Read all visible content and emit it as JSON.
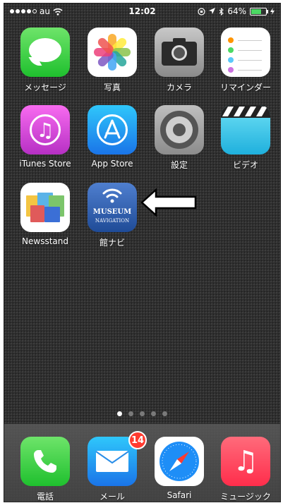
{
  "status_bar": {
    "carrier": "au",
    "time": "12:02",
    "battery": "64%"
  },
  "home_screen": {
    "apps": [
      {
        "label": "メッセージ",
        "icon": "messages-icon"
      },
      {
        "label": "写真",
        "icon": "photos-icon"
      },
      {
        "label": "カメラ",
        "icon": "camera-icon"
      },
      {
        "label": "リマインダー",
        "icon": "reminders-icon"
      },
      {
        "label": "iTunes Store",
        "icon": "itunes-store-icon"
      },
      {
        "label": "App Store",
        "icon": "app-store-icon"
      },
      {
        "label": "設定",
        "icon": "settings-icon"
      },
      {
        "label": "ビデオ",
        "icon": "videos-icon"
      },
      {
        "label": "Newsstand",
        "icon": "newsstand-icon"
      },
      {
        "label": "館ナビ",
        "icon": "museum-navigation-icon",
        "icon_text_1": "MUSEUM",
        "icon_text_2": "NAVIGATION"
      }
    ],
    "page_count": 5,
    "current_page": 1
  },
  "dock": {
    "apps": [
      {
        "label": "電話",
        "icon": "phone-icon"
      },
      {
        "label": "メール",
        "icon": "mail-icon",
        "badge": "14"
      },
      {
        "label": "Safari",
        "icon": "safari-icon"
      },
      {
        "label": "ミュージック",
        "icon": "music-icon"
      }
    ]
  },
  "colors": {
    "badge": "#ff3b30",
    "battery_fill": "#4cd964"
  }
}
